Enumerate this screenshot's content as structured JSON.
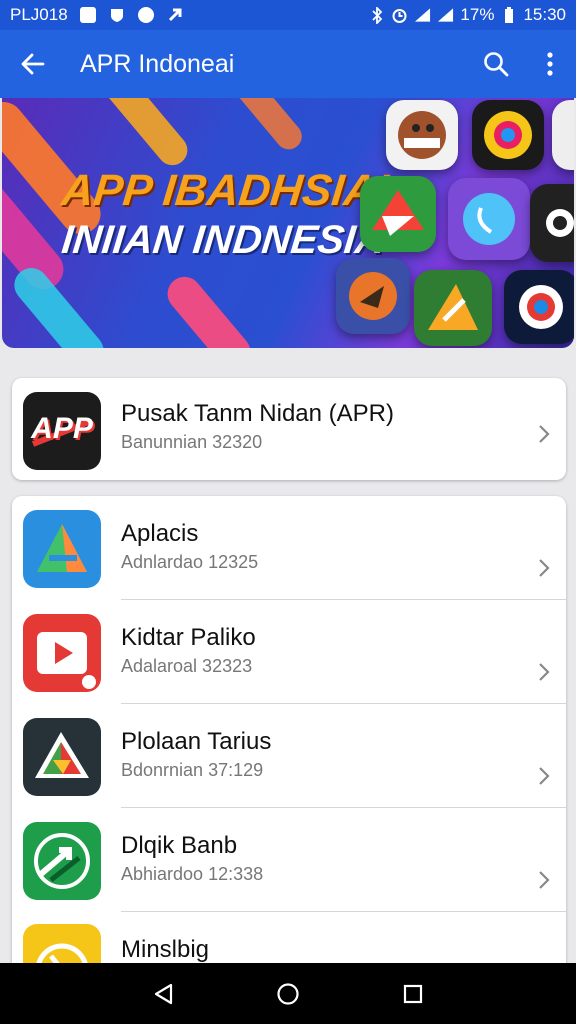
{
  "status_bar": {
    "left_text": "PLJ018",
    "battery": "17%",
    "time": "15:30"
  },
  "app_bar": {
    "title": "APR Indoneai"
  },
  "banner": {
    "line1": "APP IBADHSIAI",
    "line2": "INIIAN INDNESIA"
  },
  "featured": {
    "icon_text": "APP",
    "title": "Pusak Tanm Nidan (APR)",
    "subtitle": "Banunnian 32320"
  },
  "apps": [
    {
      "title": "Aplacis",
      "subtitle": "Adnlardao 12325",
      "icon": "triangle-a-icon",
      "color": "#2b8fe0"
    },
    {
      "title": "Kidtar Paliko",
      "subtitle": "Adalaroal 32323",
      "icon": "play-icon",
      "color": "#e53935"
    },
    {
      "title": "Plolaan Tarius",
      "subtitle": "Bdonrnian 37:129",
      "icon": "triangle-colors-icon",
      "color": "#263238"
    },
    {
      "title": "Dlqik Banb",
      "subtitle": "Abhiardoo 12:338",
      "icon": "arrows-icon",
      "color": "#1e9e4a"
    },
    {
      "title": "Minslbig",
      "subtitle": "",
      "icon": "gauge-icon",
      "color": "#f5c518"
    }
  ],
  "colors": {
    "status_bar": "#1d56d4",
    "app_bar": "#2463e0",
    "accent_orange": "#f6a21c"
  }
}
